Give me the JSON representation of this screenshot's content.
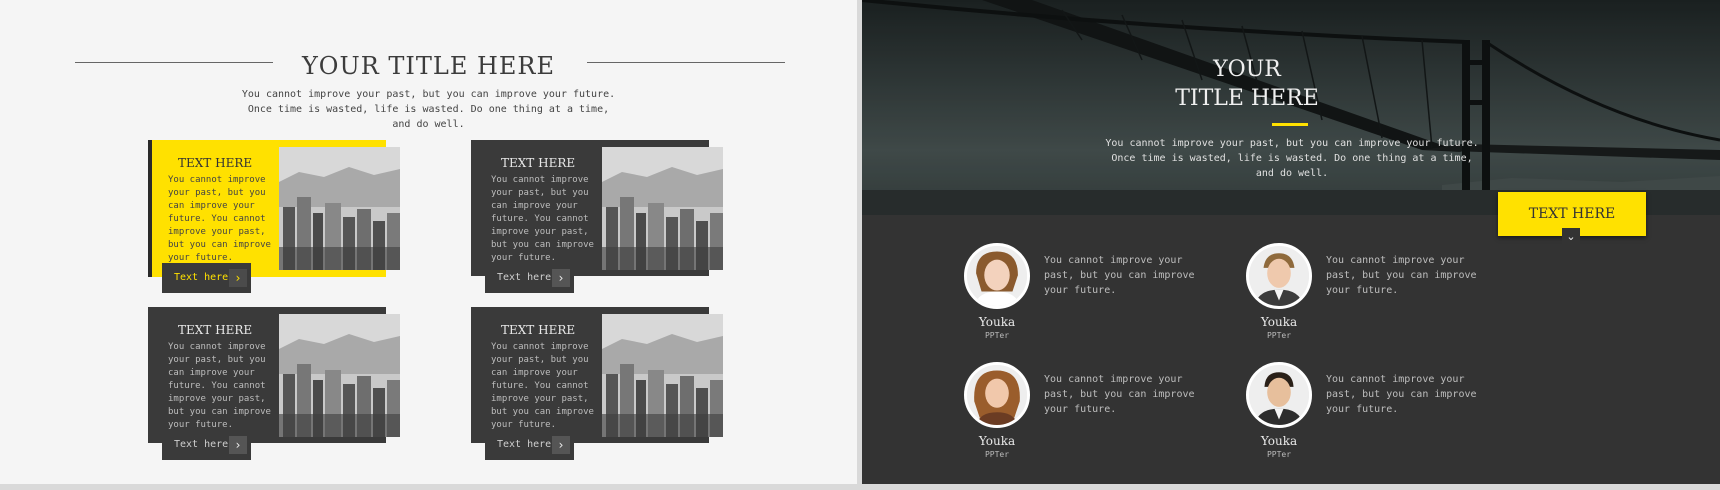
{
  "left_slide": {
    "title": "YOUR TITLE HERE",
    "subtitle": "You cannot improve your past, but you can improve your future. Once time is wasted, life is wasted. Do one thing at a time, and do well.",
    "cards": [
      {
        "title": "TEXT HERE",
        "body": "You cannot improve your past, but you can improve your future. You cannot improve your past, but you can improve your future.",
        "button_label": "Text here",
        "arrow_icon": "chevron-right-icon",
        "style": "yellow"
      },
      {
        "title": "TEXT HERE",
        "body": "You cannot improve your past, but you can improve your future. You cannot improve your past, but you can improve your future.",
        "button_label": "Text here",
        "arrow_icon": "chevron-right-icon",
        "style": "dark"
      },
      {
        "title": "TEXT HERE",
        "body": "You cannot improve your past, but you can improve your future. You cannot improve your past, but you can improve your future.",
        "button_label": "Text here",
        "arrow_icon": "chevron-right-icon",
        "style": "dark"
      },
      {
        "title": "TEXT HERE",
        "body": "You cannot improve your past, but you can improve your future. You cannot improve your past, but you can improve your future.",
        "button_label": "Text here",
        "arrow_icon": "chevron-right-icon",
        "style": "dark"
      }
    ]
  },
  "right_slide": {
    "title_line1": "YOUR",
    "title_line2": "TITLE HERE",
    "subtitle": "You cannot improve your past, but you can improve your future. Once time is wasted, life is wasted. Do one thing at a time, and do well.",
    "tag_label": "TEXT HERE",
    "tag_icon": "chevron-down-icon",
    "people": [
      {
        "name": "Youka",
        "role": "PPTer",
        "desc": "You cannot improve your past, but you can improve your future."
      },
      {
        "name": "Youka",
        "role": "PPTer",
        "desc": "You cannot improve your past, but you can improve your future."
      },
      {
        "name": "Youka",
        "role": "PPTer",
        "desc": "You cannot improve your past, but you can improve your future."
      },
      {
        "name": "Youka",
        "role": "PPTer",
        "desc": "You cannot improve your past, but you can improve your future."
      }
    ]
  },
  "colors": {
    "accent_yellow": "#ffe100",
    "dark_panel": "#3a3a3a",
    "light_bg": "#f5f5f5",
    "dark_bg": "#333333"
  }
}
